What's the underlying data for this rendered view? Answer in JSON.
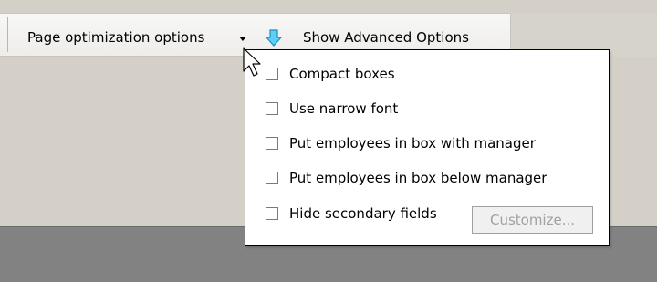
{
  "toolbar": {
    "page_optimization_label": "Page optimization options",
    "advanced_label": "Show Advanced Options"
  },
  "menu": {
    "items": [
      {
        "label": "Compact boxes",
        "checked": false
      },
      {
        "label": "Use narrow font",
        "checked": false
      },
      {
        "label": "Put employees in box with manager",
        "checked": false
      },
      {
        "label": "Put employees in box below manager",
        "checked": false
      },
      {
        "label": "Hide secondary fields",
        "checked": false
      }
    ],
    "customize_label": "Customize..."
  },
  "colors": {
    "advanced_icon": "#1fa3e0",
    "disabled_text": "#a0a0a0"
  }
}
